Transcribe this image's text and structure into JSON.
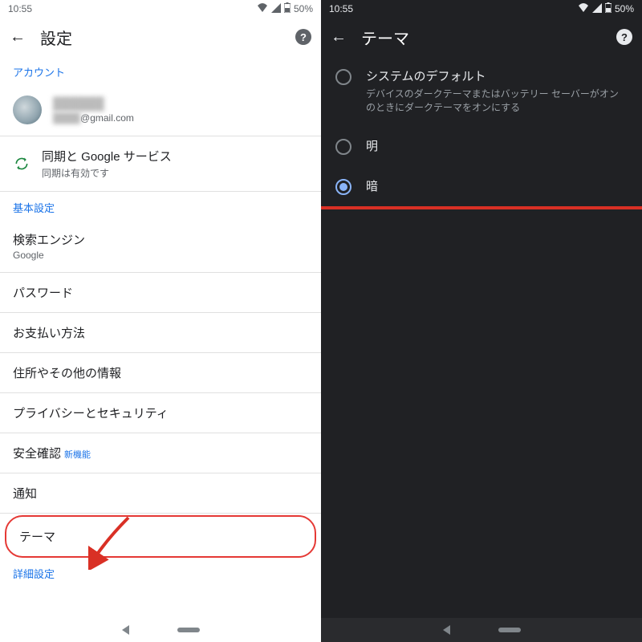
{
  "status": {
    "time": "10:55",
    "battery": "50%"
  },
  "left": {
    "title": "設定",
    "section_account": "アカウント",
    "account_email_suffix": "@gmail.com",
    "sync_title": "同期と Google サービス",
    "sync_sub": "同期は有効です",
    "section_basic": "基本設定",
    "search_engine": "検索エンジン",
    "search_engine_value": "Google",
    "password": "パスワード",
    "payment": "お支払い方法",
    "address": "住所やその他の情報",
    "privacy": "プライバシーとセキュリティ",
    "safety": "安全確認",
    "new_badge": "新機能",
    "notif": "通知",
    "theme": "テーマ",
    "advanced": "詳細設定"
  },
  "right": {
    "title": "テーマ",
    "opt1_title": "システムのデフォルト",
    "opt1_sub": "デバイスのダークテーマまたはバッテリー セーバーがオンのときにダークテーマをオンにする",
    "opt2": "明",
    "opt3": "暗"
  }
}
